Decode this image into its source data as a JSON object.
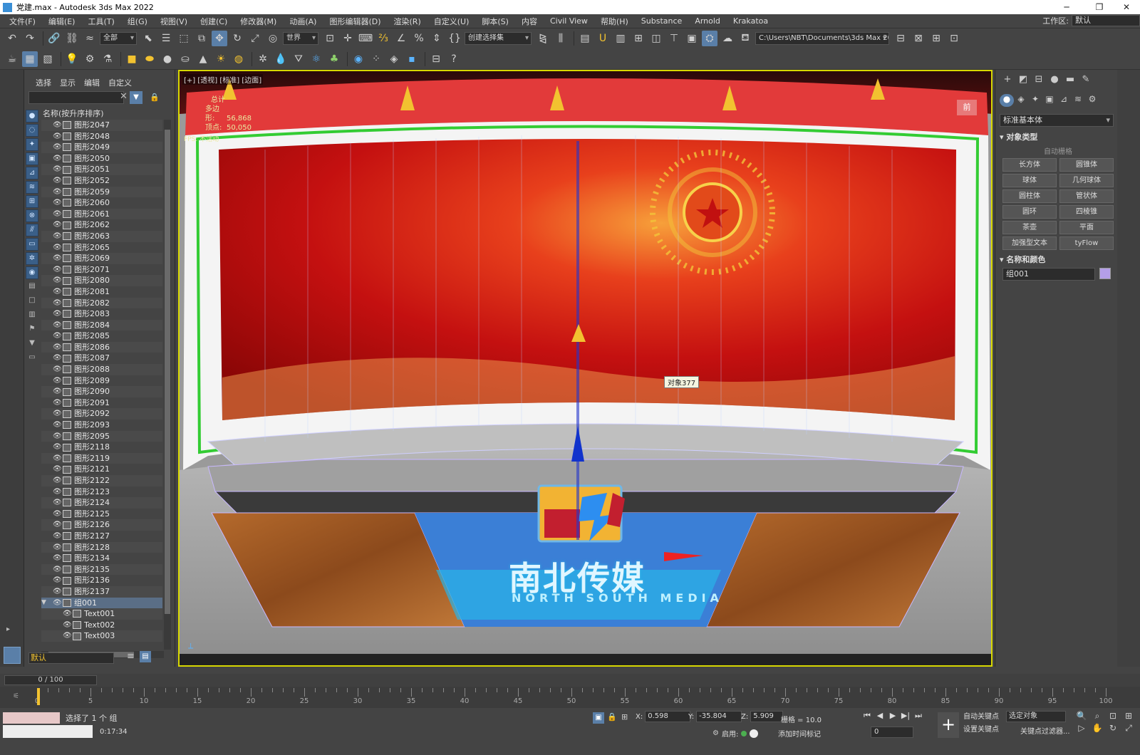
{
  "window": {
    "title": "党建.max - Autodesk 3ds Max 2022",
    "minimize": "─",
    "restore": "❐",
    "close": "✕"
  },
  "menu": {
    "items": [
      "文件(F)",
      "编辑(E)",
      "工具(T)",
      "组(G)",
      "视图(V)",
      "创建(C)",
      "修改器(M)",
      "动画(A)",
      "图形编辑器(D)",
      "渲染(R)",
      "自定义(U)",
      "脚本(S)",
      "内容",
      "Civil View",
      "帮助(H)",
      "Substance",
      "Arnold",
      "Krakatoa"
    ],
    "workspace_label": "工作区:",
    "workspace_value": "默认"
  },
  "toolbar": {
    "selection_filter": "全部",
    "ref_coord": "世界",
    "named_selection": "创建选择集",
    "project_path": "C:\\Users\\NBT\\Documents\\3ds Max 2022"
  },
  "scene_explorer": {
    "tabs": [
      "选择",
      "显示",
      "编辑",
      "自定义"
    ],
    "search_placeholder": "",
    "header": "名称(按升序排序)",
    "rows": [
      {
        "name": "图形2047"
      },
      {
        "name": "图形2048"
      },
      {
        "name": "图形2049"
      },
      {
        "name": "图形2050"
      },
      {
        "name": "图形2051"
      },
      {
        "name": "图形2052"
      },
      {
        "name": "图形2059"
      },
      {
        "name": "图形2060"
      },
      {
        "name": "图形2061"
      },
      {
        "name": "图形2062"
      },
      {
        "name": "图形2063"
      },
      {
        "name": "图形2065"
      },
      {
        "name": "图形2069"
      },
      {
        "name": "图形2071"
      },
      {
        "name": "图形2080"
      },
      {
        "name": "图形2081"
      },
      {
        "name": "图形2082"
      },
      {
        "name": "图形2083"
      },
      {
        "name": "图形2084"
      },
      {
        "name": "图形2085"
      },
      {
        "name": "图形2086"
      },
      {
        "name": "图形2087"
      },
      {
        "name": "图形2088"
      },
      {
        "name": "图形2089"
      },
      {
        "name": "图形2090"
      },
      {
        "name": "图形2091"
      },
      {
        "name": "图形2092"
      },
      {
        "name": "图形2093"
      },
      {
        "name": "图形2095"
      },
      {
        "name": "图形2118"
      },
      {
        "name": "图形2119"
      },
      {
        "name": "图形2121"
      },
      {
        "name": "图形2122"
      },
      {
        "name": "图形2123"
      },
      {
        "name": "图形2124"
      },
      {
        "name": "图形2125"
      },
      {
        "name": "图形2126"
      },
      {
        "name": "图形2127"
      },
      {
        "name": "图形2128"
      },
      {
        "name": "图形2134"
      },
      {
        "name": "图形2135"
      },
      {
        "name": "图形2136"
      },
      {
        "name": "图形2137"
      }
    ],
    "group_row": "组001",
    "child_rows": [
      "Text001",
      "Text002",
      "Text003"
    ],
    "layer": "默认"
  },
  "viewport": {
    "label": "[+] [透视] [标准] [边面]",
    "stats_title": "总计",
    "stats_polys_label": "多边形:",
    "stats_polys": "56,868",
    "stats_verts_label": "顶点:",
    "stats_verts": "50,050",
    "fps_label": "FPS:",
    "fps_value": "不活动",
    "view_cube": "前",
    "tooltip": "对象377",
    "logo_cn": "南北传媒",
    "logo_en": "NORTH SOUTH MEDIA"
  },
  "command_panel": {
    "category": "标准基本体",
    "object_type_header": "对象类型",
    "auto_grid": "自动栅格",
    "objects": [
      "长方体",
      "圆锥体",
      "球体",
      "几何球体",
      "圆柱体",
      "管状体",
      "圆环",
      "四棱锥",
      "茶壶",
      "平面",
      "加强型文本",
      "tyFlow"
    ],
    "name_color_header": "名称和颜色",
    "object_name": "组001",
    "object_color": "#b49ee8"
  },
  "timeline": {
    "frame_readout": "0 / 100",
    "tick_labels": [
      "0",
      "5",
      "10",
      "15",
      "20",
      "25",
      "30",
      "35",
      "40",
      "45",
      "50",
      "55",
      "60",
      "65",
      "70",
      "75",
      "80",
      "85",
      "90",
      "95",
      "100"
    ]
  },
  "status": {
    "selection": "选择了 1 个 组",
    "time": "0:17:34",
    "x_label": "X:",
    "x": "0.598",
    "y_label": "Y:",
    "y": "-35.804",
    "z_label": "Z:",
    "z": "5.909",
    "grid": "栅格 = 10.0",
    "enable_label": "启用:",
    "add_time_tag": "添加时间标记",
    "auto_key": "自动关键点",
    "set_key": "设置关键点",
    "selected_set": "选定对象",
    "key_filters": "关键点过滤器...",
    "frame_field": "0"
  },
  "colors": {
    "accent": "#5a7fa8",
    "viewport_border": "#d8d800"
  }
}
